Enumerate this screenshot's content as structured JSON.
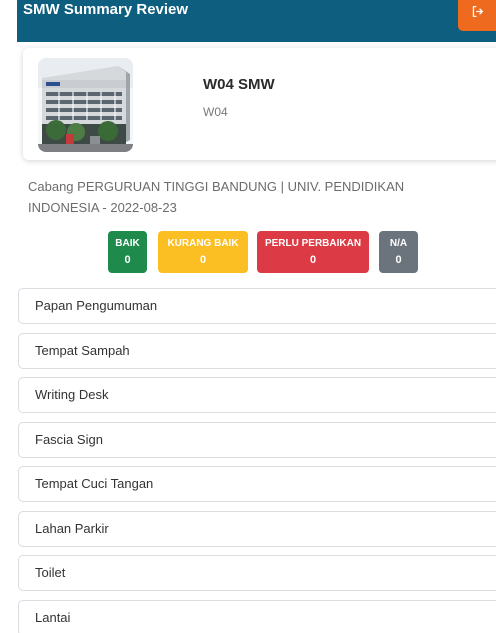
{
  "header": {
    "title": "SMW Summary Review",
    "logout_icon": "logout-icon",
    "accent_color": "#0d5e7f",
    "logout_color": "#ee6a1f"
  },
  "store": {
    "name": "W04 SMW",
    "code": "W04",
    "photo_icon": "store-building-photo"
  },
  "branch_info": "Cabang PERGURUAN TINGGI BANDUNG | UNIV. PENDIDIKAN INDONESIA - 2022-08-23",
  "badges": [
    {
      "label": "BAIK",
      "count": "0",
      "color": "#1e8a4c"
    },
    {
      "label": "KURANG BAIK",
      "count": "0",
      "color": "#fbbf24"
    },
    {
      "label": "PERLU PERBAIKAN",
      "count": "0",
      "color": "#dc3a44"
    },
    {
      "label": "N/A",
      "count": "0",
      "color": "#6b747c"
    }
  ],
  "items": [
    {
      "label": "Papan Pengumuman"
    },
    {
      "label": "Tempat Sampah"
    },
    {
      "label": "Writing Desk"
    },
    {
      "label": "Fascia Sign"
    },
    {
      "label": "Tempat Cuci Tangan"
    },
    {
      "label": "Lahan Parkir"
    },
    {
      "label": "Toilet"
    },
    {
      "label": "Lantai"
    }
  ]
}
